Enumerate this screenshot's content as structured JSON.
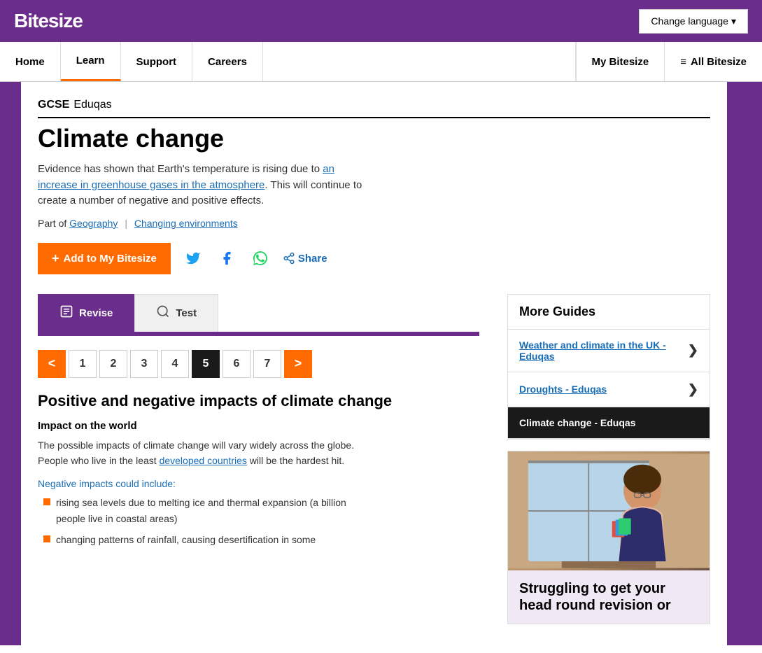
{
  "header": {
    "logo": "Bitesize",
    "change_language": "Change language",
    "nav_items": [
      "Home",
      "Learn",
      "Support",
      "Careers"
    ],
    "nav_right_items": [
      "My Bitesize",
      "All Bitesize"
    ]
  },
  "breadcrumb": {
    "level1": "GCSE",
    "level2": "Eduqas"
  },
  "page": {
    "title": "Climate change",
    "description_parts": [
      "Evidence has shown that Earth's temperature is rising due to an increase in greenhouse gases in the atmosphere. This will continue to create a number of negative and positive effects.",
      "Part of"
    ],
    "part_of_links": [
      "Geography",
      "Changing environments"
    ],
    "add_button": "Add to My Bitesize",
    "share_label": "Share"
  },
  "tabs": [
    {
      "label": "Revise",
      "icon": "📋",
      "active": true
    },
    {
      "label": "Test",
      "icon": "🔍",
      "active": false
    }
  ],
  "pagination": {
    "prev": "<",
    "next": ">",
    "pages": [
      "1",
      "2",
      "3",
      "4",
      "5",
      "6",
      "7"
    ],
    "current": "5"
  },
  "article": {
    "title": "Positive and negative impacts of climate change",
    "section_title": "Impact on the world",
    "paragraph": "The possible impacts of climate change will vary widely across the globe. People who live in the least developed countries will be the hardest hit.",
    "bullet_intro": "Negative impacts could include:",
    "bullets": [
      "rising sea levels due to melting ice and thermal expansion (a billion people live in coastal areas)",
      "changing patterns of rainfall, causing desertification in some"
    ]
  },
  "sidebar": {
    "more_guides_title": "More Guides",
    "guides": [
      {
        "text": "Weather and climate in the UK - Eduqas",
        "current": false
      },
      {
        "text": "Droughts - Eduqas",
        "current": false
      },
      {
        "text": "Climate change - Eduqas",
        "current": true
      }
    ],
    "promo_heading": "Struggling to get your head round revision or"
  },
  "icons": {
    "twitter": "🐦",
    "facebook": "f",
    "whatsapp": "✓",
    "share": "⇧",
    "menu": "≡",
    "plus": "+",
    "arrow_right": "❯"
  }
}
